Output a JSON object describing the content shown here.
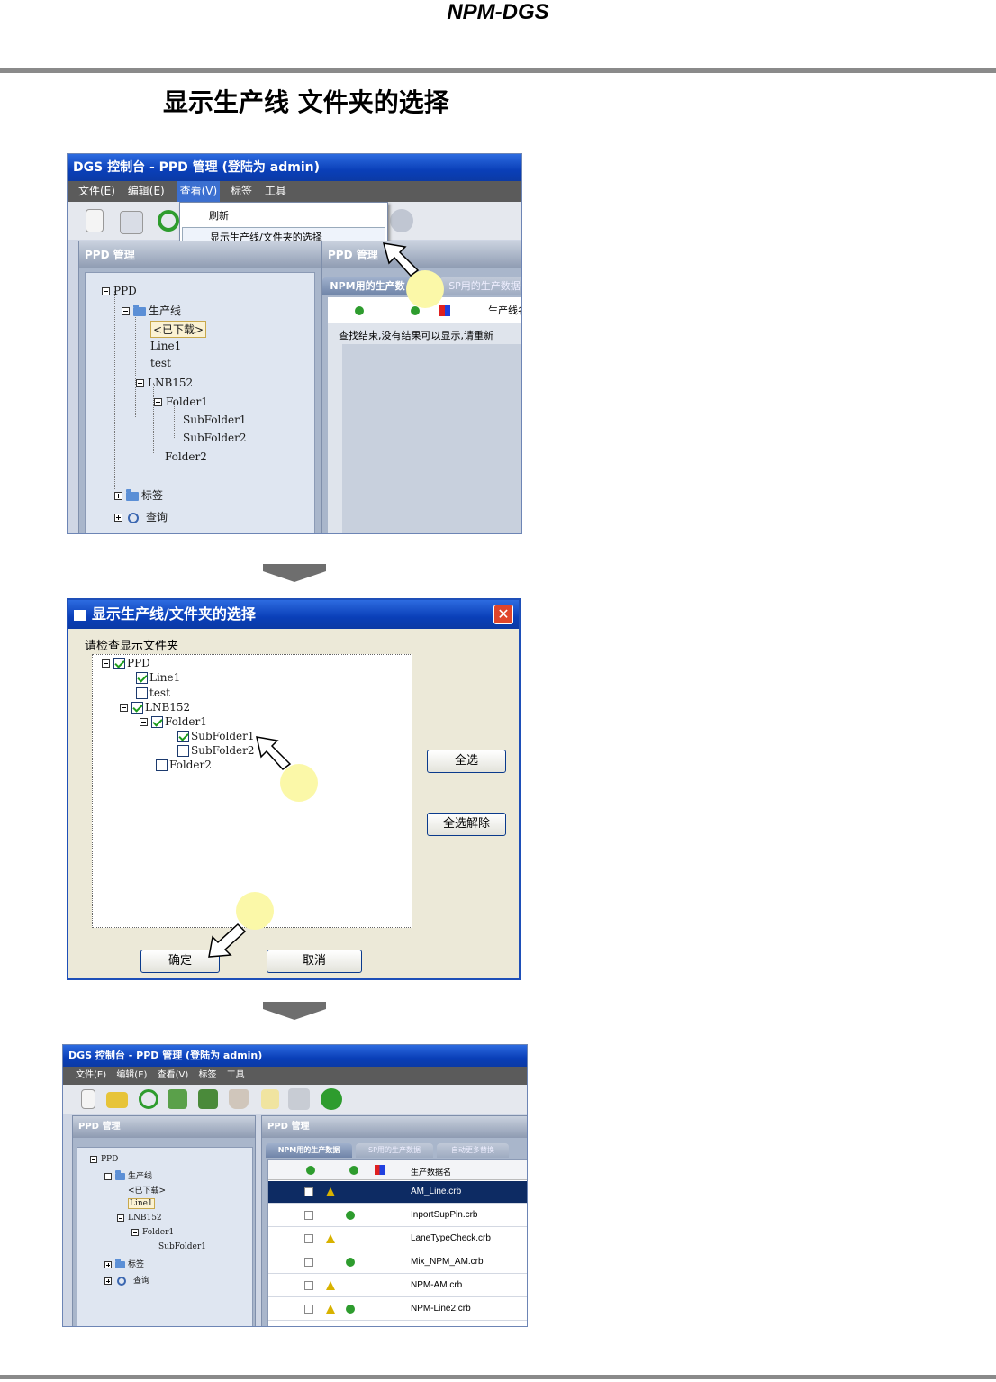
{
  "header": {
    "title": "NPM-DGS"
  },
  "section": {
    "title": "显示生产线 文件夹的选择"
  },
  "screen1": {
    "window_title": "DGS 控制台 - PPD 管理 (登陆为 admin)",
    "menu": [
      "文件(E)",
      "编辑(E)",
      "查看(V)",
      "标签",
      "工具"
    ],
    "dropdown": [
      "刷新",
      "显示生产线/文件夹的选择"
    ],
    "left_panel_title": "PPD 管理",
    "right_panel_title": "PPD 管理",
    "tabs": [
      "NPM用的生产数",
      "SP用的生产数据"
    ],
    "column_header": "生产线名",
    "message": "查找结束,没有结果可以显示,请重新",
    "tree": [
      "PPD",
      "生产线",
      "<已下载>",
      "Line1",
      "test",
      "LNB152",
      "Folder1",
      "SubFolder1",
      "SubFolder2",
      "Folder2",
      "标签",
      "查询"
    ]
  },
  "dialog": {
    "title": "显示生产线/文件夹的选择",
    "instruction": "请检查显示文件夹",
    "items": [
      "PPD",
      "Line1",
      "test",
      "LNB152",
      "Folder1",
      "SubFolder1",
      "SubFolder2",
      "Folder2"
    ],
    "select_all": "全选",
    "deselect_all": "全选解除",
    "ok": "确定",
    "cancel": "取消"
  },
  "screen3": {
    "window_title": "DGS 控制台 - PPD 管理 (登陆为 admin)",
    "menu": [
      "文件(E)",
      "编辑(E)",
      "查看(V)",
      "标签",
      "工具"
    ],
    "left_panel_title": "PPD 管理",
    "right_panel_title": "PPD 管理",
    "tabs": [
      "NPM用的生产数据",
      "SP用的生产数据",
      "自动更多替换"
    ],
    "column_header": "生产数据名",
    "tree": [
      "PPD",
      "生产线",
      "<已下载>",
      "Line1",
      "LNB152",
      "Folder1",
      "SubFolder1",
      "标签",
      "查询"
    ],
    "rows": [
      "AM_Line.crb",
      "InportSupPin.crb",
      "LaneTypeCheck.crb",
      "Mix_NPM_AM.crb",
      "NPM-AM.crb",
      "NPM-Line2.crb"
    ]
  },
  "colors": {
    "accent": "#0a3fb8",
    "highlight": "#fbf8a8",
    "rule": "#8a8a8a"
  }
}
